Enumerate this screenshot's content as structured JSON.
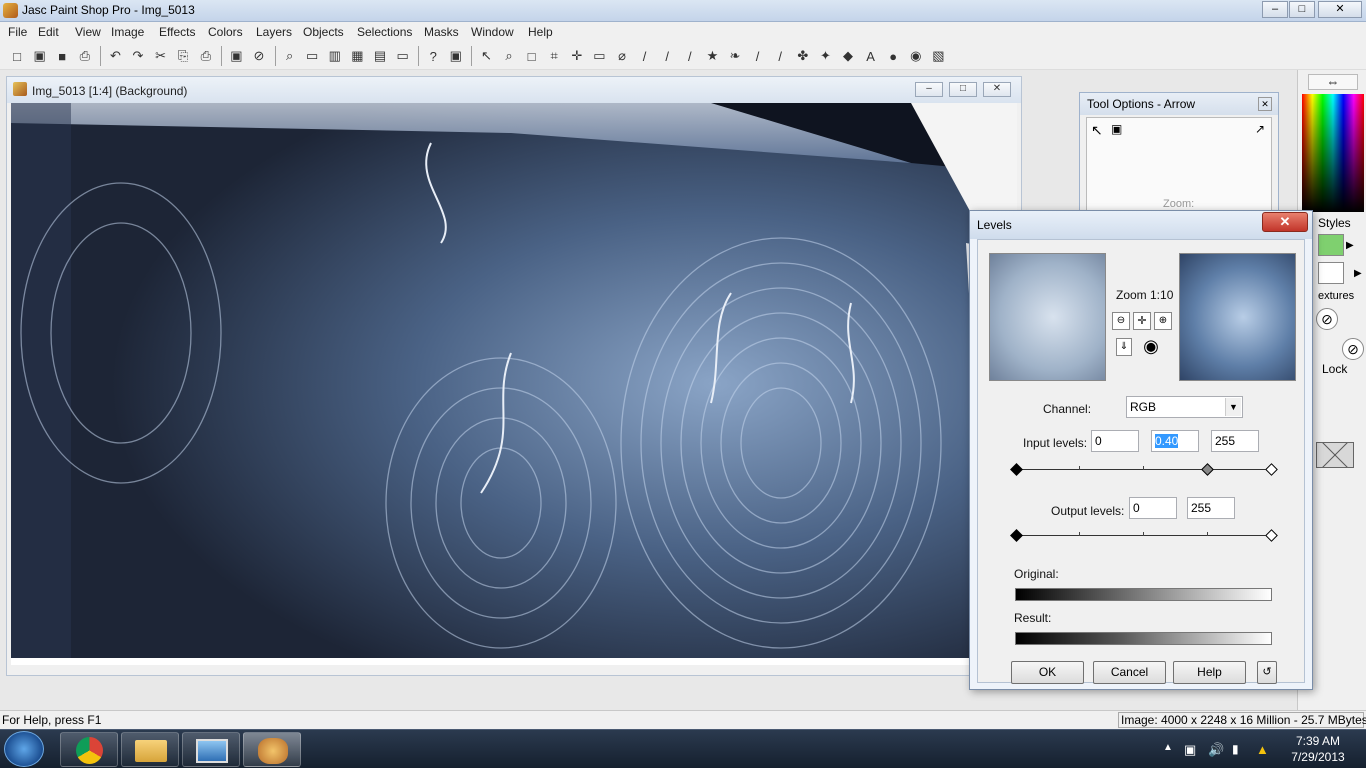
{
  "app": {
    "title": "Jasc Paint Shop Pro - Img_5013",
    "window_buttons": {
      "minimize": "–",
      "maximize": "□",
      "close": "✕"
    }
  },
  "menu": [
    "File",
    "Edit",
    "View",
    "Image",
    "Effects",
    "Colors",
    "Layers",
    "Objects",
    "Selections",
    "Masks",
    "Window",
    "Help"
  ],
  "toolbar": {
    "icons": [
      "new-icon",
      "open-icon",
      "save-icon",
      "print-icon",
      "sep",
      "undo-icon",
      "redo-icon",
      "cut-icon",
      "copy-icon",
      "paste-icon",
      "sep",
      "browse-icon",
      "cancel-icon",
      "sep",
      "zoom-icon",
      "overview-icon",
      "palette-icon",
      "histogram-icon",
      "layers-icon",
      "toolbar-icon",
      "sep",
      "help-icon",
      "camera-icon",
      "sep",
      "arrow-tool-icon",
      "zoom-tool-icon",
      "deform-icon",
      "crop-icon",
      "mover-icon",
      "selection-icon",
      "freehand-icon",
      "dropper-icon",
      "paintbrush-icon",
      "clone-icon",
      "color-replacer-icon",
      "retouch-icon",
      "scratch-icon",
      "eraser-icon",
      "picture-tube-icon",
      "airbrush-icon",
      "flood-fill-icon",
      "text-icon",
      "draw-icon",
      "preset-shapes-icon",
      "object-selector-icon"
    ],
    "glyphs": [
      "□",
      "▣",
      "■",
      "⎙",
      "",
      "↶",
      "↷",
      "✂",
      "⎘",
      "⎙",
      "",
      "▣",
      "⊘",
      "",
      "⌕",
      "▭",
      "▥",
      "▦",
      "▤",
      "▭",
      "",
      "?",
      "▣",
      "",
      "↖",
      "⌕",
      "□",
      "⌗",
      "✛",
      "▭",
      "⌀",
      "/",
      "/",
      "/",
      "★",
      "❧",
      "/",
      "/",
      "✤",
      "✦",
      "◆",
      "A",
      "●",
      "◉",
      "▧"
    ]
  },
  "image_window": {
    "title": "Img_5013 [1:4] (Background)",
    "buttons": {
      "minimize": "–",
      "maximize": "□",
      "close": "✕"
    }
  },
  "tool_options": {
    "title": "Tool Options - Arrow",
    "zoom_label": "Zoom:"
  },
  "right_panel": {
    "arrow": "⇔",
    "styles_label": "Styles",
    "textures_label": "extures",
    "lock_label": "Lock"
  },
  "levels_dialog": {
    "title": "Levels",
    "zoom_text": "Zoom 1:10",
    "channel_label": "Channel:",
    "channel_value": "RGB",
    "input_label": "Input levels:",
    "input_values": [
      "0",
      "0.40",
      "255"
    ],
    "output_label": "Output levels:",
    "output_values": [
      "0",
      "255"
    ],
    "original_label": "Original:",
    "result_label": "Result:",
    "buttons": {
      "ok": "OK",
      "cancel": "Cancel",
      "help": "Help"
    },
    "input_gamma_fraction": 0.75
  },
  "status": {
    "help_text": "For Help, press F1",
    "image_info": "Image:  4000 x 2248 x 16 Million - 25.7 MBytes"
  },
  "taskbar": {
    "apps": [
      "windows-start",
      "chrome",
      "file-explorer",
      "image-viewer",
      "paint-shop-pro"
    ],
    "time": "7:39 AM",
    "date": "7/29/2013"
  }
}
